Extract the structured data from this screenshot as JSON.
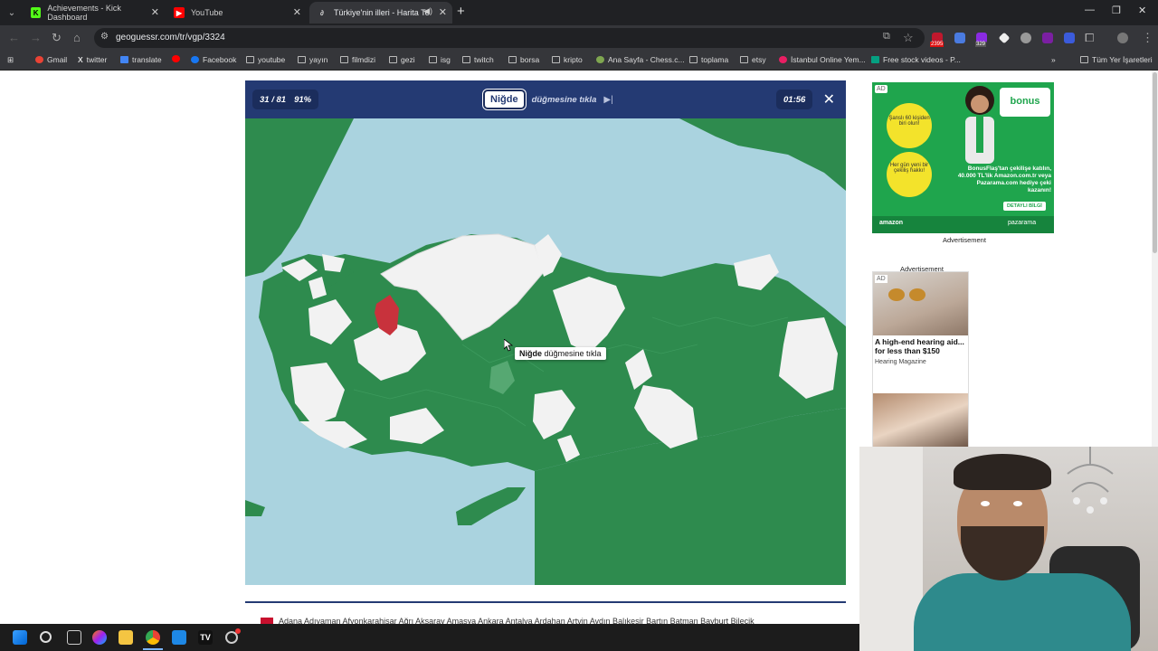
{
  "browser": {
    "tabs": [
      {
        "label": "Achievements - Kick Dashboard",
        "icon": "kick-icon",
        "active": false
      },
      {
        "label": "YouTube",
        "icon": "youtube-icon",
        "active": false
      },
      {
        "label": "Türkiye'nin illeri - Harita Te",
        "icon": "geoguessr-icon",
        "active": true
      }
    ],
    "url": "geoguessr.com/tr/vgp/3324",
    "extensions": [
      {
        "badge": "2395"
      },
      {
        "badge": "329"
      }
    ],
    "bookmarks": [
      {
        "label": "Gmail",
        "icon": "gmail-icon"
      },
      {
        "label": "twitter",
        "icon": "x-icon"
      },
      {
        "label": "translate",
        "icon": "translate-icon"
      },
      {
        "label": "",
        "icon": "youtube-icon"
      },
      {
        "label": "Facebook",
        "icon": "facebook-icon"
      },
      {
        "label": "youtube",
        "icon": "folder-icon"
      },
      {
        "label": "yayın",
        "icon": "folder-icon"
      },
      {
        "label": "filmdizi",
        "icon": "folder-icon"
      },
      {
        "label": "gezi",
        "icon": "folder-icon"
      },
      {
        "label": "isg",
        "icon": "folder-icon"
      },
      {
        "label": "twitch",
        "icon": "folder-icon"
      },
      {
        "label": "borsa",
        "icon": "folder-icon"
      },
      {
        "label": "kripto",
        "icon": "folder-icon"
      },
      {
        "label": "Ana Sayfa - Chess.c...",
        "icon": "chess-icon"
      },
      {
        "label": "toplama",
        "icon": "folder-icon"
      },
      {
        "label": "etsy",
        "icon": "folder-icon"
      },
      {
        "label": "İstanbul Online Yem...",
        "icon": "yemek-icon"
      },
      {
        "label": "Free stock videos - P...",
        "icon": "pexels-icon"
      }
    ],
    "all_bookmarks": "Tüm Yer İşaretleri"
  },
  "game": {
    "progress": "31 / 81",
    "accuracy": "91%",
    "target": "Niğde",
    "instruction": "düğmesine tıkla",
    "timer": "01:56",
    "tooltip_bold": "Niğde",
    "tooltip_rest": " düğmesine tıkla",
    "colors": {
      "header": "#243a73",
      "sea": "#aad3df",
      "correct": "#2e8b4e",
      "wrong": "#c8323c",
      "unanswered": "#f2f2f2"
    },
    "bottom_text": "Adana  Adıyaman  Afyonkarahisar  Ağrı  Aksaray  Amasya  Ankara  Antalya  Ardahan  Artvin  Aydın  Balıkesir  Bartın  Batman  Bayburt  Bilecik"
  },
  "ads": {
    "ad1": {
      "badge": "AD",
      "circle1": "Şanslı 60 kişiden biri olun!",
      "circle2": "Her gün yeni bir çekiliş hakkı!",
      "brand": "bonus",
      "copy": "BonusFlaş'tan çekilişe katılın, 40.000 TL'lik Amazon.com.tr veya Pazarama.com hediye çeki kazanın!",
      "button": "DETAYLI BİLGİ",
      "amazon": "amazon",
      "pazarama": "pazarama",
      "label": "Advertisement"
    },
    "ad2": {
      "label": "Advertisement",
      "badge": "AD",
      "headline": "A high-end hearing aid... for less than $150",
      "source": "Hearing Magazine"
    }
  }
}
